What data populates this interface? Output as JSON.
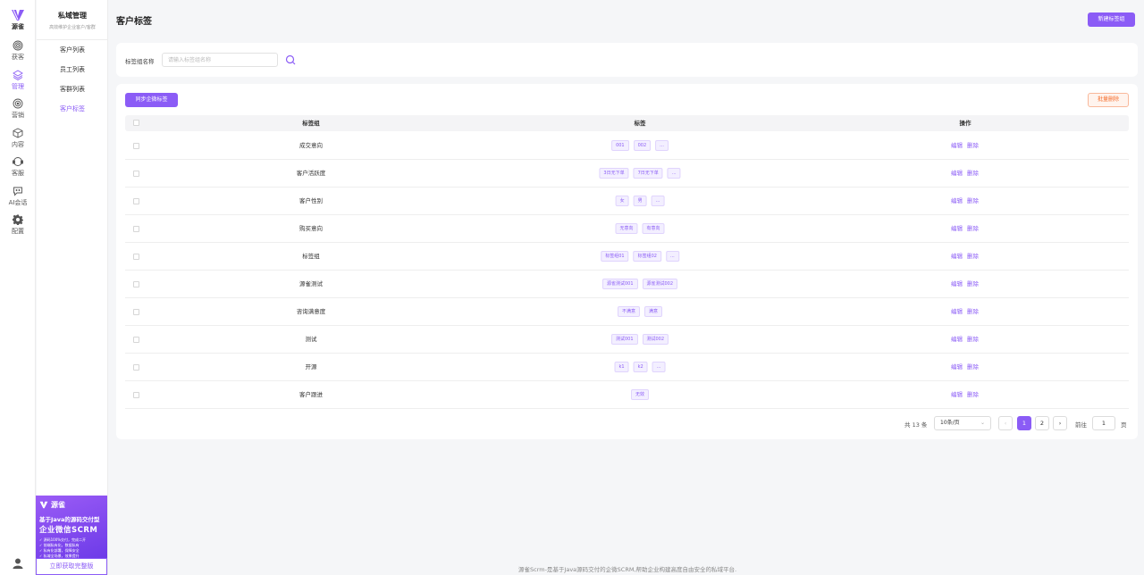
{
  "rail": {
    "logo_text": "源雀",
    "items": [
      {
        "label": "获客",
        "icon": "fingerprint-icon"
      },
      {
        "label": "管理",
        "icon": "layers-icon"
      },
      {
        "label": "营销",
        "icon": "target-icon"
      },
      {
        "label": "内容",
        "icon": "cube-icon"
      },
      {
        "label": "客服",
        "icon": "headset-icon"
      },
      {
        "label": "AI会话",
        "icon": "chat-icon"
      },
      {
        "label": "配置",
        "icon": "gear-icon"
      }
    ],
    "active_index": 1
  },
  "sidebar": {
    "title": "私域管理",
    "subtitle": "高效维护企业客户/客群",
    "items": [
      {
        "label": "客户列表"
      },
      {
        "label": "员工列表"
      },
      {
        "label": "客群列表"
      },
      {
        "label": "客户标签"
      }
    ],
    "active_index": 3
  },
  "promo": {
    "brand": "源雀",
    "line1": "基于Java的源码交付型",
    "line2": "企业微信SCRM",
    "bullets": [
      "✓ 源码100%交付，完成二开",
      "✓ 前端私有化，数据私有",
      "✓ 私有化部署，保障安全",
      "✓ 私域全场景，效果提升"
    ],
    "button": "立即获取完整版"
  },
  "header": {
    "title": "客户标签",
    "new_button": "新建标签组"
  },
  "filter": {
    "label": "标签组名称",
    "placeholder": "请输入标签组名称",
    "value": ""
  },
  "toolbar": {
    "sync_button": "同步企微标签",
    "batch_delete": "批量删除"
  },
  "table": {
    "columns": [
      "标签组",
      "标签",
      "操作"
    ],
    "actions": {
      "edit": "编辑",
      "delete": "删除"
    },
    "rows": [
      {
        "group": "成交意向",
        "tags": [
          "001",
          "002",
          "..."
        ]
      },
      {
        "group": "客户活跃度",
        "tags": [
          "3日无下单",
          "7日无下单",
          "..."
        ]
      },
      {
        "group": "客户性别",
        "tags": [
          "女",
          "男",
          "..."
        ]
      },
      {
        "group": "购买意向",
        "tags": [
          "无意向",
          "有意向"
        ]
      },
      {
        "group": "标签组",
        "tags": [
          "标签组01",
          "标签组02",
          "..."
        ]
      },
      {
        "group": "源雀测试",
        "tags": [
          "源雀测试001",
          "源雀测试002"
        ]
      },
      {
        "group": "咨询满意度",
        "tags": [
          "不满意",
          "满意"
        ]
      },
      {
        "group": "测试",
        "tags": [
          "测试001",
          "测试002"
        ]
      },
      {
        "group": "开源",
        "tags": [
          "k1",
          "k2",
          "..."
        ]
      },
      {
        "group": "客户跟进",
        "tags": [
          "无效"
        ]
      }
    ]
  },
  "pagination": {
    "total_text": "共 13 条",
    "page_size": "10条/页",
    "prev": "‹",
    "next": "›",
    "pages": [
      "1",
      "2"
    ],
    "current": "1",
    "goto_label": "前往",
    "goto_value": "1",
    "goto_unit": "页"
  },
  "footer": "源雀Scrm-是基于Java源码交付的企微SCRM,帮助企业构建高度自由安全的私域平台.",
  "colors": {
    "accent": "#8b5cf6",
    "danger": "#f56c2b"
  }
}
